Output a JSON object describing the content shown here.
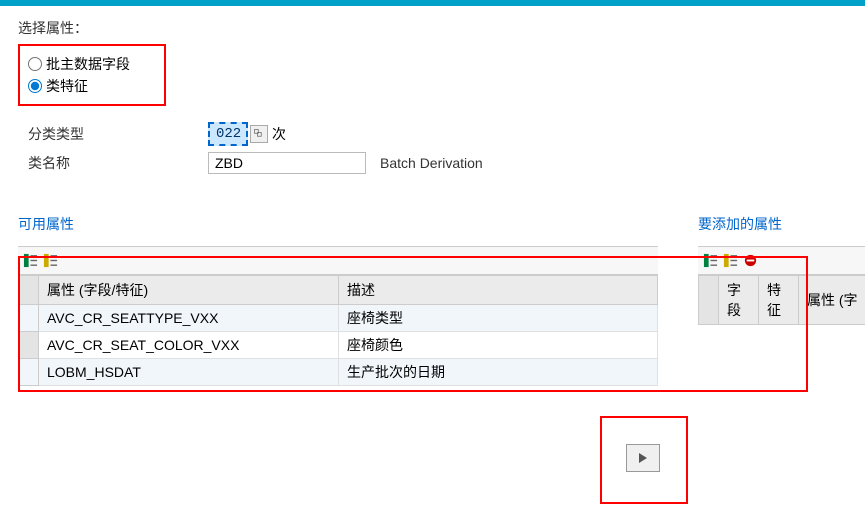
{
  "header": {
    "select_attr_label": "选择属性："
  },
  "radios": {
    "option1_label": "批主数据字段",
    "option2_label": "类特征"
  },
  "form": {
    "class_type_label": "分类类型",
    "class_type_value": "022",
    "class_type_suffix": "次",
    "class_name_label": "类名称",
    "class_name_value": "ZBD",
    "class_name_desc": "Batch Derivation"
  },
  "panels": {
    "available_title": "可用属性",
    "to_add_title": "要添加的属性"
  },
  "available_table": {
    "col_attr": "属性 (字段/特征)",
    "col_desc": "描述",
    "rows": [
      {
        "attr": "AVC_CR_SEATTYPE_VXX",
        "desc": "座椅类型"
      },
      {
        "attr": "AVC_CR_SEAT_COLOR_VXX",
        "desc": "座椅颜色"
      },
      {
        "attr": "LOBM_HSDAT",
        "desc": "生产批次的日期"
      }
    ]
  },
  "to_add_table": {
    "col_field": "字段",
    "col_char": "特征",
    "col_attr": "属性 (字"
  }
}
